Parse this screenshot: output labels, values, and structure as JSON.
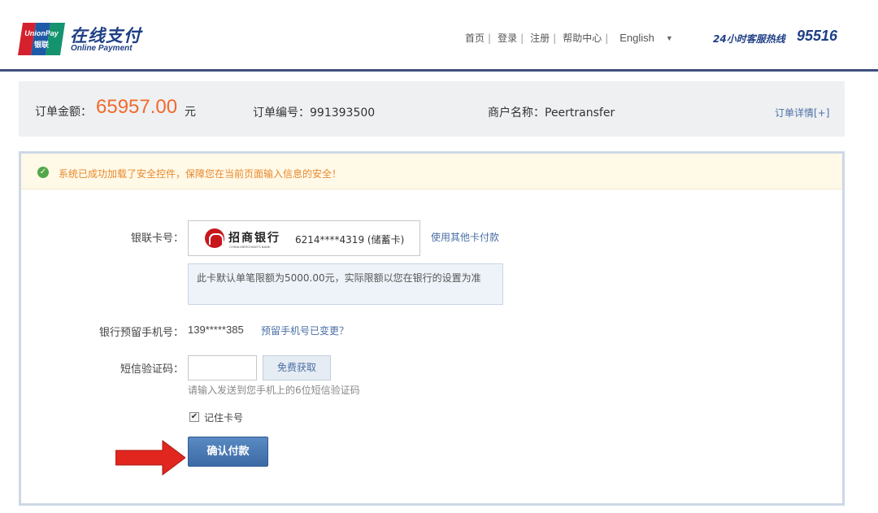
{
  "header": {
    "logo_text_top": "UnionPay",
    "logo_text_bottom": "银联",
    "brand_cn": "在线支付",
    "brand_en": "Online Payment",
    "nav": [
      {
        "label": "首页"
      },
      {
        "label": "登录"
      },
      {
        "label": "注册"
      },
      {
        "label": "帮助中心"
      }
    ],
    "language": "English",
    "hotline_label": "24小时客服热线",
    "hotline_number": "95516"
  },
  "order": {
    "amount_label": "订单金额：",
    "amount": "65957.00",
    "unit": "元",
    "order_no": "订单编号：991393500",
    "merchant": "商户名称：Peertransfer",
    "detail_link": "订单详情[+]"
  },
  "notice": {
    "text": "系统已成功加载了安全控件，保障您在当前页面输入信息的安全！",
    "icon": "check-circle-icon"
  },
  "form": {
    "card_label": "银联卡号：",
    "bank_name": "招商银行",
    "bank_name_en": "CHINA MERCHANTS BANK",
    "card_number": "6214****4319 (储蓄卡)",
    "other_card": "使用其他卡付款",
    "limit_tip": "此卡默认单笔限额为5000.00元，实际限额以您在银行的设置为准",
    "phone_label": "银行预留手机号：",
    "phone_value": "139*****385",
    "phone_change": "预留手机号已变更？",
    "sms_label": "短信验证码：",
    "sms_value": "",
    "sms_button": "免费获取",
    "sms_hint": "请输入发送到您手机上的6位短信验证码",
    "remember_checked": true,
    "remember_label": "记住卡号",
    "confirm_button": "确认付款"
  },
  "colors": {
    "brand_blue": "#1f3f86",
    "amount_orange": "#f06a2b",
    "link_blue": "#4a6fa5",
    "notice_orange": "#e8892b",
    "arrow_red": "#e0261e",
    "bank_red": "#c8161d"
  }
}
